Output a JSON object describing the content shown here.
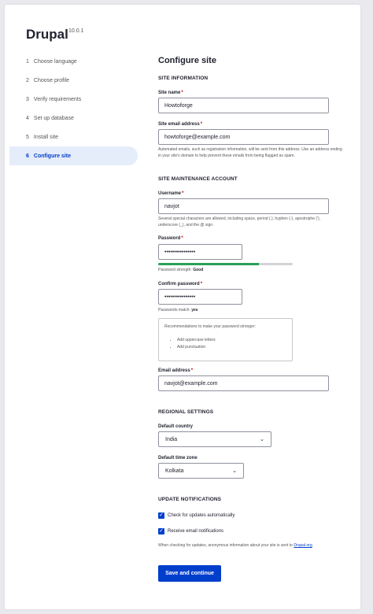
{
  "app": {
    "name": "Drupal",
    "version": "10.0.1"
  },
  "steps": [
    {
      "num": "1",
      "label": "Choose language"
    },
    {
      "num": "2",
      "label": "Choose profile"
    },
    {
      "num": "3",
      "label": "Verify requirements"
    },
    {
      "num": "4",
      "label": "Set up database"
    },
    {
      "num": "5",
      "label": "Install site"
    },
    {
      "num": "6",
      "label": "Configure site"
    }
  ],
  "active_step": "6",
  "page_title": "Configure site",
  "site_info": {
    "heading": "SITE INFORMATION",
    "site_name_label": "Site name",
    "site_name_value": "Howtoforge",
    "site_email_label": "Site email address",
    "site_email_value": "howtoforge@example.com",
    "site_email_desc": "Automated emails, such as registration information, will be sent from this address. Use an address ending in your site's domain to help prevent these emails from being flagged as spam."
  },
  "maintenance": {
    "heading": "SITE MAINTENANCE ACCOUNT",
    "username_label": "Username",
    "username_value": "navjot",
    "username_desc": "Several special characters are allowed, including space, period (.), hyphen (-), apostrophe ('), underscore (_), and the @ sign.",
    "password_label": "Password",
    "password_value": "••••••••••••••••",
    "strength_prefix": "Password strength:",
    "strength_value": "Good",
    "strength_fraction": 0.75,
    "confirm_label": "Confirm password",
    "confirm_value": "••••••••••••••••",
    "match_prefix": "Passwords match:",
    "match_value": "yes",
    "recommend_title": "Recommendations to make your password stronger:",
    "recommend_items": [
      "Add uppercase letters",
      "Add punctuation"
    ],
    "email_label": "Email address",
    "email_value": "navjot@example.com"
  },
  "regional": {
    "heading": "REGIONAL SETTINGS",
    "country_label": "Default country",
    "country_value": "India",
    "timezone_label": "Default time zone",
    "timezone_value": "Kolkata"
  },
  "updates": {
    "heading": "UPDATE NOTIFICATIONS",
    "check_auto_label": "Check for updates automatically",
    "check_auto_checked": true,
    "receive_email_label": "Receive email notifications",
    "receive_email_checked": true,
    "desc_prefix": "When checking for updates, anonymous information about your site is sent to",
    "desc_link": "Drupal.org",
    "desc_suffix": "."
  },
  "submit_label": "Save and continue",
  "colors": {
    "accent": "#003ecc",
    "active_bg": "#e5ecfa",
    "strength": "#2aa05a",
    "required": "#d10000"
  }
}
